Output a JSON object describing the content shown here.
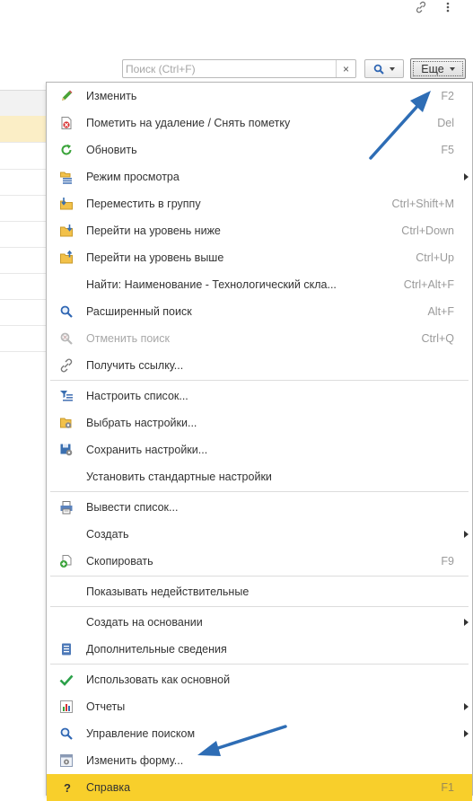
{
  "toolbar": {
    "search_placeholder": "Поиск (Ctrl+F)",
    "clear_glyph": "×",
    "more_label": "Еще"
  },
  "menu": {
    "items": [
      {
        "label": "Изменить",
        "shortcut": "F2",
        "icon": "pencil-icon"
      },
      {
        "label": "Пометить на удаление / Снять пометку",
        "shortcut": "Del",
        "icon": "delete-mark-icon"
      },
      {
        "label": "Обновить",
        "shortcut": "F5",
        "icon": "refresh-icon"
      },
      {
        "label": "Режим просмотра",
        "shortcut": "",
        "icon": "view-mode-icon",
        "submenu": true
      },
      {
        "label": "Переместить в группу",
        "shortcut": "Ctrl+Shift+M",
        "icon": "move-to-group-icon"
      },
      {
        "label": "Перейти на уровень ниже",
        "shortcut": "Ctrl+Down",
        "icon": "level-down-icon"
      },
      {
        "label": "Перейти на уровень выше",
        "shortcut": "Ctrl+Up",
        "icon": "level-up-icon"
      },
      {
        "label": "Найти: Наименование - Технологический скла...",
        "shortcut": "Ctrl+Alt+F",
        "icon": ""
      },
      {
        "label": "Расширенный поиск",
        "shortcut": "Alt+F",
        "icon": "search-icon"
      },
      {
        "label": "Отменить поиск",
        "shortcut": "Ctrl+Q",
        "icon": "cancel-search-icon",
        "disabled": true
      },
      {
        "label": "Получить ссылку...",
        "shortcut": "",
        "icon": "link-icon"
      },
      {
        "label": "Настроить список...",
        "shortcut": "",
        "icon": "list-settings-icon"
      },
      {
        "label": "Выбрать настройки...",
        "shortcut": "",
        "icon": "select-settings-icon"
      },
      {
        "label": "Сохранить настройки...",
        "shortcut": "",
        "icon": "save-settings-icon"
      },
      {
        "label": "Установить стандартные настройки",
        "shortcut": "",
        "icon": ""
      },
      {
        "label": "Вывести список...",
        "shortcut": "",
        "icon": "print-list-icon"
      },
      {
        "label": "Создать",
        "shortcut": "",
        "icon": "",
        "submenu": true
      },
      {
        "label": "Скопировать",
        "shortcut": "F9",
        "icon": "copy-icon"
      },
      {
        "label": "Показывать недействительные",
        "shortcut": "",
        "icon": ""
      },
      {
        "label": "Создать на основании",
        "shortcut": "",
        "icon": "",
        "submenu": true
      },
      {
        "label": "Дополнительные сведения",
        "shortcut": "",
        "icon": "additional-info-icon"
      },
      {
        "label": "Использовать как основной",
        "shortcut": "",
        "icon": "checkmark-icon"
      },
      {
        "label": "Отчеты",
        "shortcut": "",
        "icon": "reports-icon",
        "submenu": true
      },
      {
        "label": "Управление поиском",
        "shortcut": "",
        "icon": "search-icon",
        "submenu": true
      },
      {
        "label": "Изменить форму...",
        "shortcut": "",
        "icon": "form-settings-icon"
      },
      {
        "label": "Справка",
        "shortcut": "F1",
        "icon": "help-icon",
        "highlighted": true
      }
    ]
  },
  "colors": {
    "highlight": "#f8cf2b",
    "selected_row": "#fbeec6",
    "annotation_arrow": "#2e6db5"
  }
}
